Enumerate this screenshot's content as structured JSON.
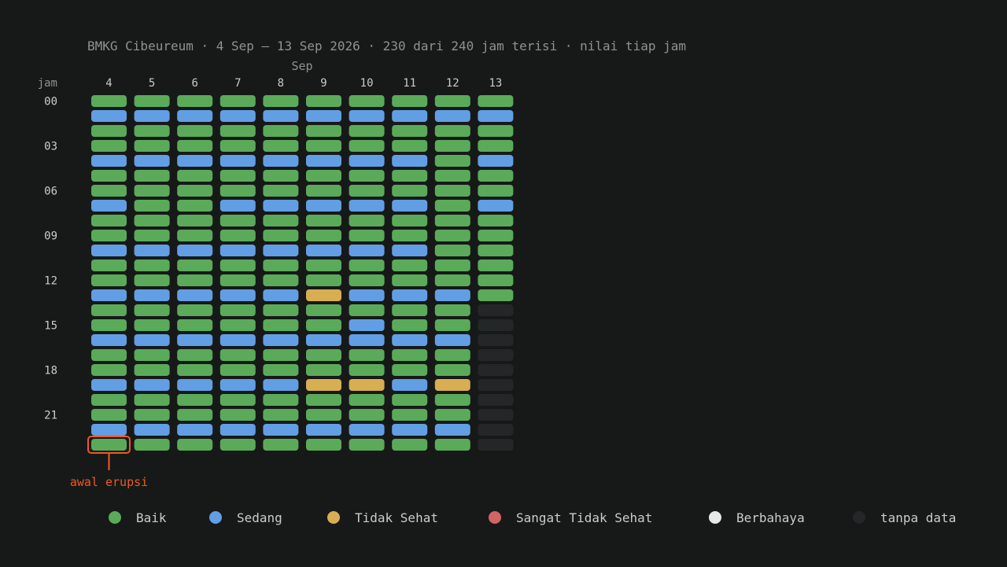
{
  "chart_data": {
    "type": "heatmap",
    "title": "BMKG Cibeureum · 4 Sep – 13 Sep 2026 · 230 dari 240 jam terisi · nilai tiap jam",
    "month_label": "Sep",
    "row_axis_label": "jam",
    "columns": [
      "4",
      "5",
      "6",
      "7",
      "8",
      "9",
      "10",
      "11",
      "12",
      "13"
    ],
    "row_tick_labels": [
      "00",
      "03",
      "06",
      "09",
      "12",
      "15",
      "18",
      "21"
    ],
    "categories": [
      {
        "key": "B",
        "name": "Baik",
        "color": "#5aaa5a"
      },
      {
        "key": "S",
        "name": "Sedang",
        "color": "#629ee4"
      },
      {
        "key": "T",
        "name": "Tidak Sehat",
        "color": "#d8ae53"
      },
      {
        "key": "ST",
        "name": "Sangat Tidak Sehat",
        "color": "#d26464"
      },
      {
        "key": "BH",
        "name": "Berbahaya",
        "color": "#e6e8e8"
      },
      {
        "key": "N",
        "name": "tanpa data",
        "color": "#242727"
      }
    ],
    "grid": [
      [
        "B",
        "B",
        "B",
        "B",
        "B",
        "B",
        "B",
        "B",
        "B",
        "B"
      ],
      [
        "S",
        "S",
        "S",
        "S",
        "S",
        "S",
        "S",
        "S",
        "S",
        "S"
      ],
      [
        "B",
        "B",
        "B",
        "B",
        "B",
        "B",
        "B",
        "B",
        "B",
        "B"
      ],
      [
        "B",
        "B",
        "B",
        "B",
        "B",
        "B",
        "B",
        "B",
        "B",
        "B"
      ],
      [
        "S",
        "S",
        "S",
        "S",
        "S",
        "S",
        "S",
        "S",
        "B",
        "S"
      ],
      [
        "B",
        "B",
        "B",
        "B",
        "B",
        "B",
        "B",
        "B",
        "B",
        "B"
      ],
      [
        "B",
        "B",
        "B",
        "B",
        "B",
        "B",
        "B",
        "B",
        "B",
        "B"
      ],
      [
        "S",
        "B",
        "B",
        "S",
        "S",
        "S",
        "S",
        "S",
        "B",
        "S"
      ],
      [
        "B",
        "B",
        "B",
        "B",
        "B",
        "B",
        "B",
        "B",
        "B",
        "B"
      ],
      [
        "B",
        "B",
        "B",
        "B",
        "B",
        "B",
        "B",
        "B",
        "B",
        "B"
      ],
      [
        "S",
        "S",
        "S",
        "S",
        "S",
        "S",
        "S",
        "S",
        "B",
        "B"
      ],
      [
        "B",
        "B",
        "B",
        "B",
        "B",
        "B",
        "B",
        "B",
        "B",
        "B"
      ],
      [
        "B",
        "B",
        "B",
        "B",
        "B",
        "B",
        "B",
        "B",
        "B",
        "B"
      ],
      [
        "S",
        "S",
        "S",
        "S",
        "S",
        "T",
        "S",
        "S",
        "S",
        "B"
      ],
      [
        "B",
        "B",
        "B",
        "B",
        "B",
        "B",
        "B",
        "B",
        "B",
        "N"
      ],
      [
        "B",
        "B",
        "B",
        "B",
        "B",
        "B",
        "S",
        "B",
        "B",
        "N"
      ],
      [
        "S",
        "S",
        "S",
        "S",
        "S",
        "S",
        "S",
        "S",
        "S",
        "N"
      ],
      [
        "B",
        "B",
        "B",
        "B",
        "B",
        "B",
        "B",
        "B",
        "B",
        "N"
      ],
      [
        "B",
        "B",
        "B",
        "B",
        "B",
        "B",
        "B",
        "B",
        "B",
        "N"
      ],
      [
        "S",
        "S",
        "S",
        "S",
        "S",
        "T",
        "T",
        "S",
        "T",
        "N"
      ],
      [
        "B",
        "B",
        "B",
        "B",
        "B",
        "B",
        "B",
        "B",
        "B",
        "N"
      ],
      [
        "B",
        "B",
        "B",
        "B",
        "B",
        "B",
        "B",
        "B",
        "B",
        "N"
      ],
      [
        "S",
        "S",
        "S",
        "S",
        "S",
        "S",
        "S",
        "S",
        "S",
        "N"
      ],
      [
        "B",
        "B",
        "B",
        "B",
        "B",
        "B",
        "B",
        "B",
        "B",
        "N"
      ]
    ],
    "annotation": {
      "label": "awal erupsi",
      "day": "4",
      "hour": 23,
      "color": "#f05a1e"
    }
  }
}
